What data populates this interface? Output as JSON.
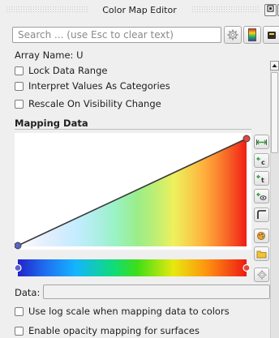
{
  "window": {
    "title": "Color Map Editor"
  },
  "search": {
    "placeholder": "Search ... (use Esc to clear text)",
    "value": ""
  },
  "array_name": "Array Name: U",
  "options_top": [
    {
      "label": "Lock Data Range",
      "checked": false
    },
    {
      "label": "Interpret Values As Categories",
      "checked": false
    },
    {
      "label": "Rescale On Visibility Change",
      "checked": false
    }
  ],
  "mapping": {
    "section_title": "Mapping Data",
    "data_label": "Data:",
    "data_value": "",
    "colors": {
      "point_fill": "#e5483e",
      "start_point": "#5a63c9",
      "line": "#3a3a3a"
    }
  },
  "options_bottom": [
    {
      "label": "Use log scale when mapping data to colors",
      "checked": false
    },
    {
      "label": "Enable opacity mapping for surfaces",
      "checked": false
    }
  ],
  "icons": {
    "gear": "gear-icon",
    "colormap": "colormap-presets-icon",
    "more": "more-options-icon"
  }
}
